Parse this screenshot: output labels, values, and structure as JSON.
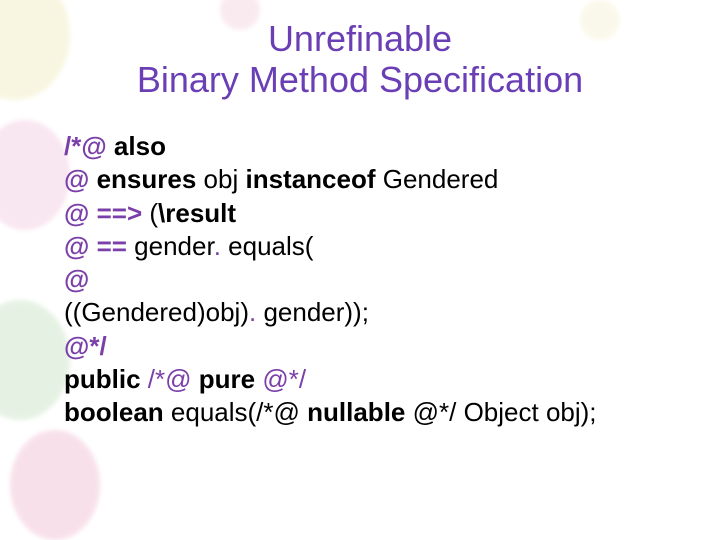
{
  "title": {
    "line1": "Unrefinable",
    "line2": "Binary Method Specification"
  },
  "code": {
    "l1_a": "/*@ ",
    "l1_b": "also",
    "l2_a": "  @   ",
    "l2_b": "ensures",
    "l2_c": " obj ",
    "l2_d": "instanceof",
    "l2_e": " Gendered",
    "l3_a": "  @        ",
    "l3_b": "==>",
    "l3_c": " (",
    "l3_d": "\\result",
    "l4_a": "  @                 ",
    "l4_b": "==",
    "l4_c": " gender",
    "l4_d": ".",
    "l4_e": " equals(",
    "l5_a": "  @",
    "l6_a": "((Gendered)obj)",
    "l6_b": ".",
    "l6_c": " gender));",
    "l7_a": "  @*/",
    "l8_a": "public",
    "l8_b": " /*@ ",
    "l8_c": "pure",
    "l8_d": " @*/",
    "l9_a": "boolean",
    "l9_b": " equals(/*@ ",
    "l9_c": "nullable",
    "l9_d": " @*/ Object obj);"
  }
}
